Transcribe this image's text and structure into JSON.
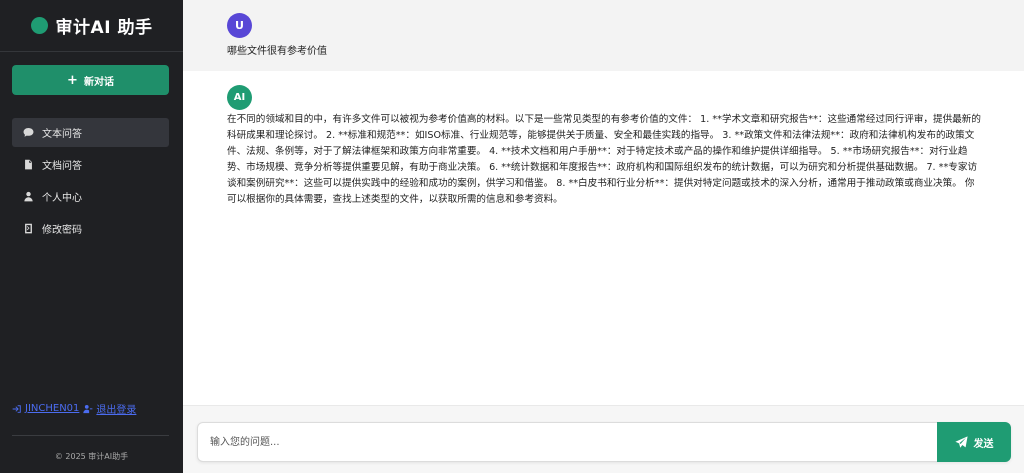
{
  "sidebar": {
    "brand_title": "审计AI 助手",
    "new_chat_icon": "plus-icon",
    "new_chat_label": "新对话",
    "items": [
      {
        "label": "文本问答",
        "icon": "chat-bubble-icon",
        "active": true
      },
      {
        "label": "文档问答",
        "icon": "document-icon",
        "active": false
      },
      {
        "label": "个人中心",
        "icon": "user-tie-icon",
        "active": false
      },
      {
        "label": "修改密码",
        "icon": "password-icon",
        "active": false
      }
    ],
    "user_name": "JINCHEN01",
    "logout_label": "退出登录",
    "copyright": "© 2025 审计AI助手"
  },
  "chat": {
    "user_avatar": "U",
    "user_message": "哪些文件很有参考价值",
    "ai_avatar": "AI",
    "ai_message": "在不同的领域和目的中，有许多文件可以被视为参考价值高的材料。以下是一些常见类型的有参考价值的文件： 1. **学术文章和研究报告**：这些通常经过同行评审，提供最新的科研成果和理论探讨。 2. **标准和规范**：如ISO标准、行业规范等，能够提供关于质量、安全和最佳实践的指导。 3. **政策文件和法律法规**：政府和法律机构发布的政策文件、法规、条例等，对于了解法律框架和政策方向非常重要。 4. **技术文档和用户手册**：对于特定技术或产品的操作和维护提供详细指导。 5. **市场研究报告**：对行业趋势、市场规模、竞争分析等提供重要见解，有助于商业决策。 6. **统计数据和年度报告**：政府机构和国际组织发布的统计数据，可以为研究和分析提供基础数据。 7. **专家访谈和案例研究**：这些可以提供实践中的经验和成功的案例，供学习和借鉴。 8. **白皮书和行业分析**：提供对特定问题或技术的深入分析，通常用于推动政策或商业决策。 你可以根据你的具体需要，查找上述类型的文件，以获取所需的信息和参考资料。"
  },
  "input": {
    "placeholder": "输入您的问题...",
    "value": "",
    "send_label": "发送",
    "send_icon": "paper-plane-icon"
  },
  "colors": {
    "accent": "#1f9c73",
    "sidebar_bg": "#1f2023",
    "user_avatar": "#5847d6",
    "link": "#4b6cf0"
  }
}
